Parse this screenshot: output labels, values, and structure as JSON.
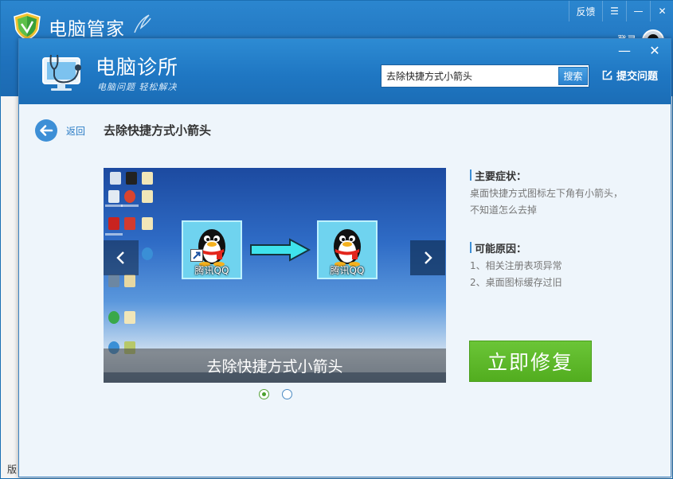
{
  "main_window": {
    "title": "电脑管家",
    "controls": {
      "feedback": "反馈",
      "menu": "☰",
      "minimize": "—",
      "close": "✕"
    },
    "login": "登录",
    "version_fragment": "版"
  },
  "clinic": {
    "title": "电脑诊所",
    "slogan": "电脑问题  轻松解决",
    "controls": {
      "minimize": "—",
      "close": "✕"
    },
    "search": {
      "value": "去除快捷方式小箭头",
      "button_label": "搜索"
    },
    "submit_question_label": "提交问题",
    "back_label": "返回",
    "page_title": "去除快捷方式小箭头",
    "carousel": {
      "caption": "去除快捷方式小箭头",
      "tiles": [
        {
          "label": "腾讯QQ"
        },
        {
          "label": "腾讯QQ"
        }
      ],
      "slide_count": 2,
      "active_slide": 1
    },
    "symptoms": {
      "heading": "主要症状：",
      "lines": [
        "桌面快捷方式图标左下角有小箭头，",
        "不知道怎么去掉"
      ]
    },
    "causes": {
      "heading": "可能原因：",
      "lines": [
        "1、相关注册表项异常",
        "2、桌面图标缓存过旧"
      ]
    },
    "fix_button_label": "立即修复"
  },
  "colors": {
    "title_bar_blue": "#1f77c3",
    "panel_background": "#eef5fb",
    "link_blue": "#2a7cc6",
    "fix_green": "#5cb82a",
    "tile_cyan": "#6fd3ef"
  }
}
